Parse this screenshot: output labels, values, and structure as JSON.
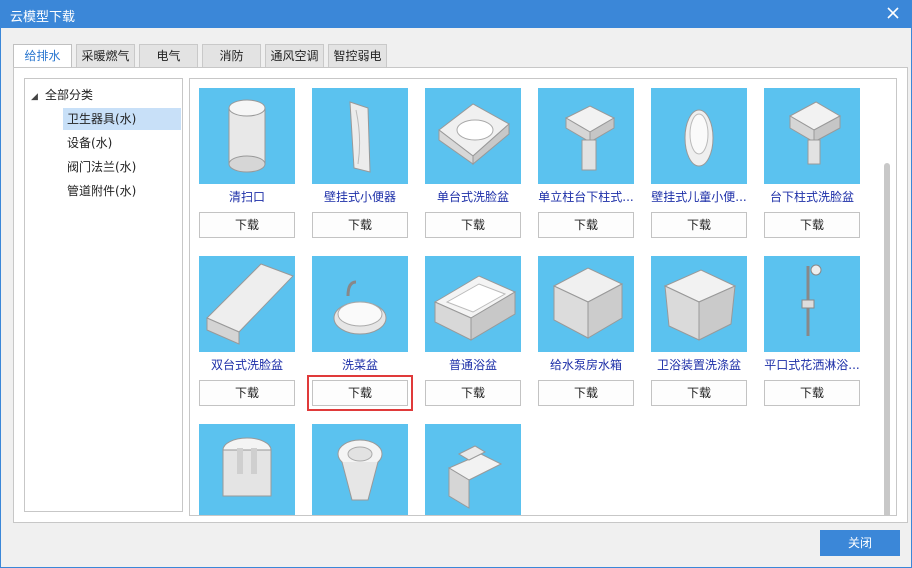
{
  "window": {
    "title": "云模型下载",
    "close_icon": "close-icon"
  },
  "tabs": [
    {
      "label": "给排水",
      "active": true
    },
    {
      "label": "采暖燃气"
    },
    {
      "label": "电气"
    },
    {
      "label": "消防"
    },
    {
      "label": "通风空调"
    },
    {
      "label": "智控弱电"
    }
  ],
  "tree": {
    "root": "全部分类",
    "items": [
      {
        "label": "卫生器具(水)",
        "selected": true
      },
      {
        "label": "设备(水)"
      },
      {
        "label": "阀门法兰(水)"
      },
      {
        "label": "管道附件(水)"
      }
    ]
  },
  "models": [
    {
      "name": "清扫口",
      "download": "下载"
    },
    {
      "name": "壁挂式小便器",
      "download": "下载"
    },
    {
      "name": "单台式洗脸盆",
      "download": "下载"
    },
    {
      "name": "单立柱台下柱式...",
      "download": "下载"
    },
    {
      "name": "壁挂式儿童小便...",
      "download": "下载"
    },
    {
      "name": "台下柱式洗脸盆",
      "download": "下载"
    },
    {
      "name": "双台式洗脸盆",
      "download": "下载"
    },
    {
      "name": "洗菜盆",
      "download": "下载",
      "highlighted": true
    },
    {
      "name": "普通浴盆",
      "download": "下载"
    },
    {
      "name": "给水泵房水箱",
      "download": "下载"
    },
    {
      "name": "卫浴装置洗涤盆",
      "download": "下载"
    },
    {
      "name": "平口式花洒淋浴...",
      "download": "下载"
    }
  ],
  "footer": {
    "close_label": "关闭"
  },
  "colors": {
    "accent": "#3b87d8",
    "thumb_bg": "#5bc2ef",
    "highlight": "#e03a3a",
    "link": "#1d2fa8"
  }
}
